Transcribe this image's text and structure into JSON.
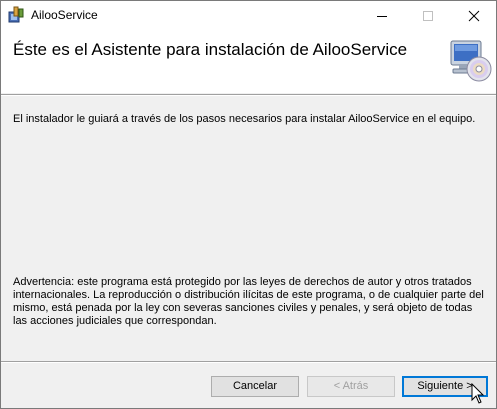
{
  "window": {
    "title": "AilooService"
  },
  "header": {
    "title": "Éste es el Asistente para instalación de AilooService"
  },
  "body": {
    "intro": "El instalador le guiará a través de los pasos necesarios para instalar AilooService en el equipo.",
    "warning": "Advertencia: este programa está protegido por las leyes de derechos de autor y otros tratados internacionales. La reproducción o distribución ilícitas de este programa, o de cualquier parte del mismo, está penada por la ley con severas sanciones civiles y penales, y será objeto de todas las acciones judiciales que correspondan."
  },
  "buttons": {
    "cancel": "Cancelar",
    "back": "< Atrás",
    "next": "Siguiente >"
  },
  "states": {
    "back_enabled": false,
    "next_focused": true
  },
  "icons": {
    "app": "installer-package-icon",
    "header": "computer-cd-setup-icon",
    "minimize": "minimize-icon",
    "maximize": "maximize-icon",
    "close": "close-icon",
    "cursor": "mouse-pointer-icon"
  }
}
